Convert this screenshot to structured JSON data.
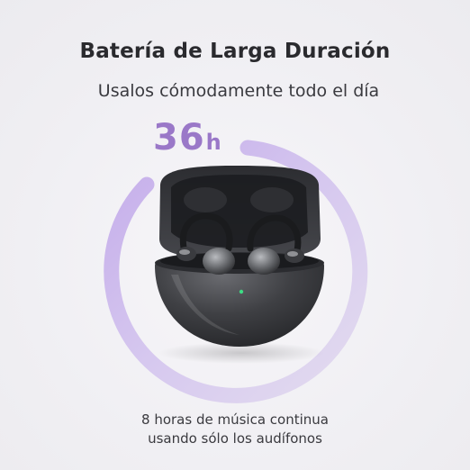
{
  "header": {
    "title": "Batería de Larga Duración",
    "subtitle": "Usalos cómodamente todo el día"
  },
  "battery": {
    "value": "36",
    "unit": "h",
    "accent_color": "#9a78c8",
    "ring_color": "#c8b3e6"
  },
  "product": {
    "name_icon": "earbuds-case-image",
    "led_color": "#3ddc84"
  },
  "footer": {
    "line1": "8 horas de música continua",
    "line2": "usando sólo los audífonos"
  }
}
